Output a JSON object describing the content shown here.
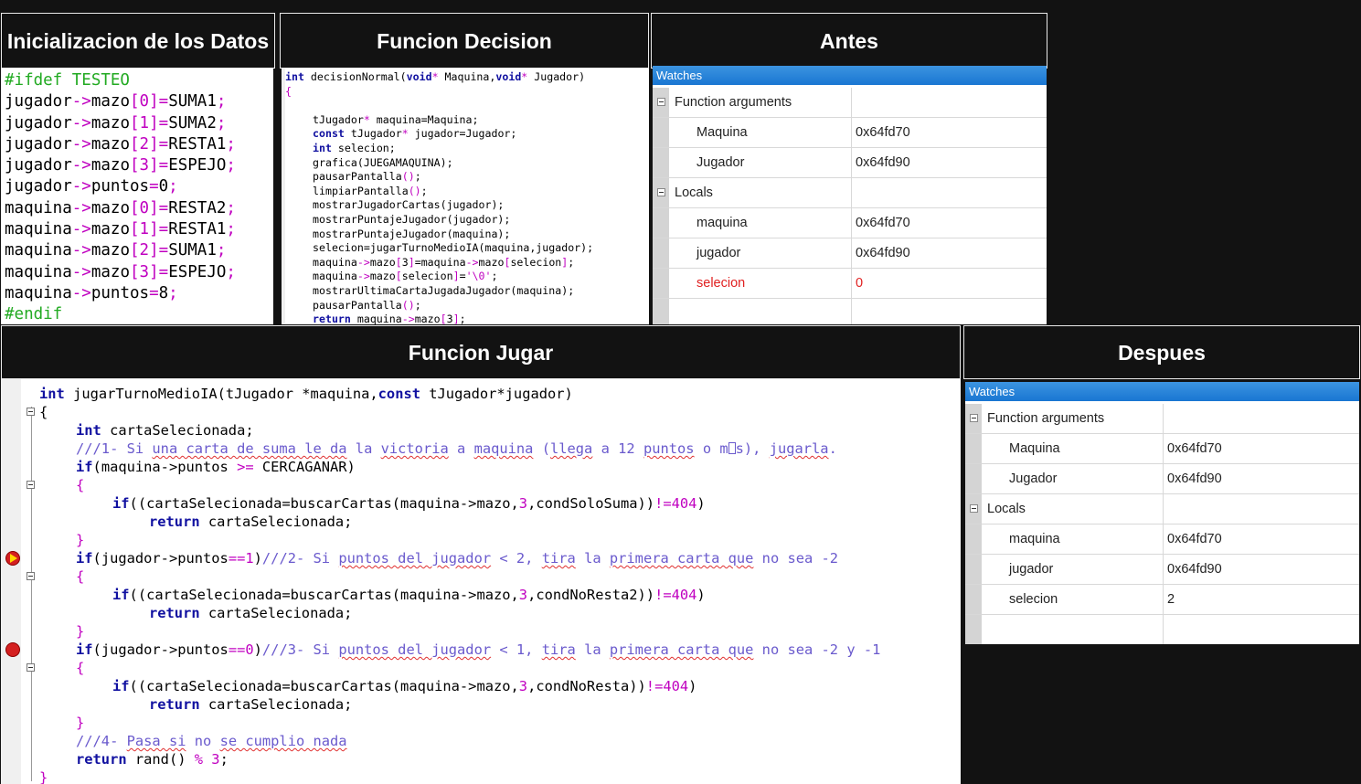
{
  "headers": {
    "init": "Inicializacion de los Datos",
    "decision": "Funcion Decision",
    "antes": "Antes",
    "jugar": "Funcion Jugar",
    "despues": "Despues"
  },
  "init_code": [
    "#ifdef TESTEO",
    "jugador->mazo[0]=SUMA1;",
    "jugador->mazo[1]=SUMA2;",
    "jugador->mazo[2]=RESTA1;",
    "jugador->mazo[3]=ESPEJO;",
    "jugador->puntos=0;",
    "maquina->mazo[0]=RESTA2;",
    "maquina->mazo[1]=RESTA1;",
    "maquina->mazo[2]=SUMA1;",
    "maquina->mazo[3]=ESPEJO;",
    "maquina->puntos=8;",
    "#endif"
  ],
  "decision_code": {
    "signature": "int decisionNormal(void* Maquina,void* Jugador)",
    "open": "{",
    "body": [
      "",
      "tJugador* maquina=Maquina;",
      "const tJugador* jugador=Jugador;",
      "int selecion;",
      "grafica(JUEGAMAQUINA);",
      "pausarPantalla();",
      "limpiarPantalla();",
      "mostrarJugadorCartas(jugador);",
      "mostrarPuntajeJugador(jugador);",
      "mostrarPuntajeJugador(maquina);",
      "selecion=jugarTurnoMedioIA(maquina,jugador);",
      "maquina->mazo[3]=maquina->mazo[selecion];",
      "maquina->mazo[selecion]='\\0';",
      "mostrarUltimaCartaJugadaJugador(maquina);",
      "pausarPantalla();",
      "return maquina->mazo[3];"
    ],
    "close": "}"
  },
  "watches_title": "Watches",
  "antes_watch": {
    "rows": [
      {
        "name": "Function arguments",
        "value": "",
        "group": true
      },
      {
        "name": "Maquina",
        "value": "0x64fd70"
      },
      {
        "name": "Jugador",
        "value": "0x64fd90"
      },
      {
        "name": "Locals",
        "value": "",
        "group": true
      },
      {
        "name": "maquina",
        "value": "0x64fd70"
      },
      {
        "name": "jugador",
        "value": "0x64fd90"
      },
      {
        "name": "selecion",
        "value": "0",
        "changed": true
      }
    ]
  },
  "despues_watch": {
    "rows": [
      {
        "name": "Function arguments",
        "value": "",
        "group": true
      },
      {
        "name": "Maquina",
        "value": "0x64fd70"
      },
      {
        "name": "Jugador",
        "value": "0x64fd90"
      },
      {
        "name": "Locals",
        "value": "",
        "group": true
      },
      {
        "name": "maquina",
        "value": "0x64fd70"
      },
      {
        "name": "jugador",
        "value": "0x64fd90"
      },
      {
        "name": "selecion",
        "value": "2"
      }
    ]
  },
  "jugar_code": {
    "l1_kw": "int",
    "l1_rest": " jugarTurnoMedioIA(tJugador *maquina,",
    "l1_kw2": "const",
    "l1_rest2": " tJugador*jugador)",
    "brace_open": "{",
    "decl_kw": "int",
    "decl_rest": " cartaSelecionada;",
    "c1_a": "///1- Si ",
    "c1_w1": "una carta de suma le da",
    "c1_b": " la ",
    "c1_w2": "victoria",
    "c1_c": " a ",
    "c1_w3": "maquina",
    "c1_d": " (",
    "c1_w4": "llega",
    "c1_e": " a 12 ",
    "c1_w5": "puntos",
    "c1_f": " o m",
    "c1_g": "s), ",
    "c1_w6": "jugarla",
    "c1_h": ".",
    "if1_kw": "if",
    "if1_rest": "(maquina->puntos ",
    "if1_op": ">=",
    "if1_rest2": " CERCAGANAR)",
    "b_open": "{",
    "b_close": "}",
    "inner_if_kw": "if",
    "s1_a": "((cartaSelecionada=buscarCartas(maquina->mazo,",
    "num3": "3",
    "s1_b": ",condSoloSuma))",
    "neq": "!=404",
    "s1_c": ")",
    "ret_kw": "return",
    "ret_rest": " cartaSelecionada;",
    "if2_rest": "(jugador->puntos",
    "if2_op": "==1",
    "if2_close": ")",
    "c2_a": "///2- Si ",
    "c2_w1": "puntos del jugador",
    "c2_b": " < 2, ",
    "c2_w2": "tira",
    "c2_c": " la ",
    "c2_w3": "primera carta que",
    "c2_d": " no sea -2",
    "s2_b": ",condNoResta2))",
    "if3_op": "==0",
    "c3_a": "///3- Si ",
    "c3_w1": "puntos del jugador",
    "c3_b": " < 1, ",
    "c3_w2": "tira",
    "c3_c": " la ",
    "c3_w3": "primera carta que",
    "c3_d": " no sea -2 y -1",
    "s3_b": ",condNoResta))",
    "c4_a": "///4- ",
    "c4_w1": "Pasa si",
    "c4_b": " no ",
    "c4_w2": "se cumplio nada",
    "last_kw": "return",
    "last_rest": " rand() ",
    "last_op": "%",
    "last_num": " 3",
    "last_end": ";",
    "brace_close": "}"
  }
}
